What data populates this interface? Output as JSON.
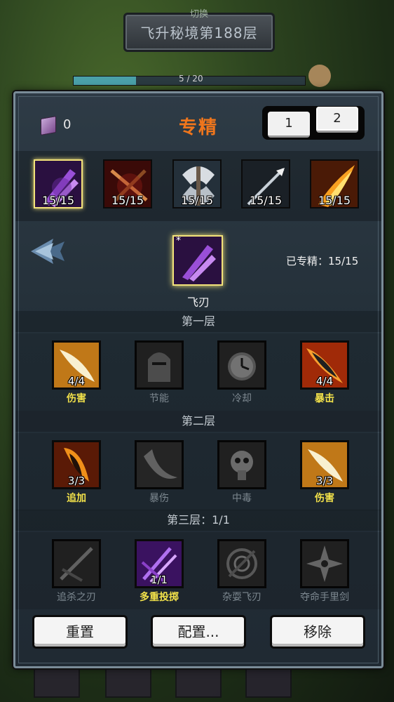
{
  "background": {
    "switch_label": "切换",
    "dungeon_title": "飞升秘境第188层",
    "green_text": "",
    "progress_text": "5 / 20",
    "progress_fraction": 0.27
  },
  "header": {
    "gem_count": "0",
    "title": "专精",
    "tabs": [
      {
        "label": "1"
      },
      {
        "label": "2"
      }
    ]
  },
  "heroes": [
    {
      "count": "15/15",
      "icon": "purple-blade-icon",
      "selected": true
    },
    {
      "count": "15/15",
      "icon": "crossbow-icon",
      "selected": false
    },
    {
      "count": "15/15",
      "icon": "battle-axe-icon",
      "selected": false
    },
    {
      "count": "15/15",
      "icon": "arrow-icon",
      "selected": false
    },
    {
      "count": "15/15",
      "icon": "fire-slash-icon",
      "selected": false
    }
  ],
  "selected": {
    "star": "*",
    "name": "飞刃",
    "spec_label": "已专精：",
    "spec_value": "15/15"
  },
  "tiers": [
    {
      "title": "第一层",
      "skills": [
        {
          "name": "伤害",
          "count": "4/4",
          "active": true,
          "icon": "golden-blade-icon"
        },
        {
          "name": "节能",
          "count": "",
          "active": false,
          "icon": "knight-helmet-icon"
        },
        {
          "name": "冷却",
          "count": "",
          "active": false,
          "icon": "clock-icon"
        },
        {
          "name": "暴击",
          "count": "4/4",
          "active": true,
          "icon": "fire-dagger-icon"
        }
      ]
    },
    {
      "title": "第二层",
      "skills": [
        {
          "name": "追加",
          "count": "3/3",
          "active": true,
          "icon": "flaming-claw-icon"
        },
        {
          "name": "暴伤",
          "count": "",
          "active": false,
          "icon": "curved-blade-icon"
        },
        {
          "name": "中毒",
          "count": "",
          "active": false,
          "icon": "skull-icon"
        },
        {
          "name": "伤害",
          "count": "3/3",
          "active": true,
          "icon": "golden-blade-icon"
        }
      ]
    },
    {
      "title": "第三层：",
      "title_value": "1/1",
      "skills": [
        {
          "name": "追杀之刃",
          "count": "",
          "active": false,
          "icon": "crossed-swords-icon"
        },
        {
          "name": "多重投掷",
          "count": "1/1",
          "active": true,
          "icon": "purple-multi-blade-icon"
        },
        {
          "name": "杂耍飞刃",
          "count": "",
          "active": false,
          "icon": "spinning-blade-icon"
        },
        {
          "name": "夺命手里剑",
          "count": "",
          "active": false,
          "icon": "shuriken-icon"
        }
      ]
    }
  ],
  "buttons": {
    "reset": "重置",
    "config": "配置...",
    "remove": "移除"
  },
  "colors": {
    "title_orange": "#f0761c",
    "active_label": "#f3e24a",
    "selected_border": "#f3e27a"
  }
}
